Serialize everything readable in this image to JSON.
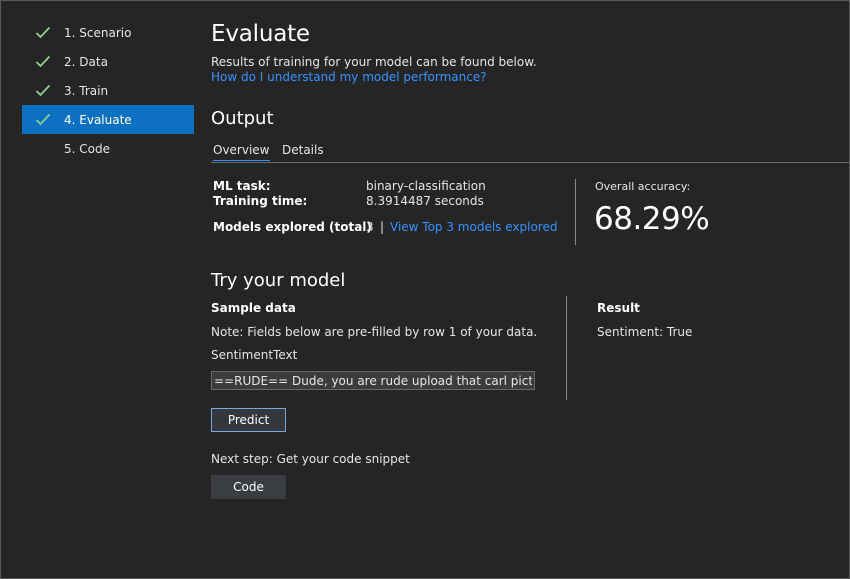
{
  "sidebar": {
    "steps": [
      {
        "label": "1. Scenario",
        "completed": true
      },
      {
        "label": "2. Data",
        "completed": true
      },
      {
        "label": "3. Train",
        "completed": true
      },
      {
        "label": "4. Evaluate",
        "completed": true,
        "active": true
      },
      {
        "label": "5. Code",
        "completed": false
      }
    ]
  },
  "header": {
    "title": "Evaluate",
    "subtitle": "Results of training for your model can be found below.",
    "help_link": "How do I understand my model performance?"
  },
  "output": {
    "title": "Output",
    "tabs": [
      {
        "label": "Overview",
        "selected": true
      },
      {
        "label": "Details",
        "selected": false
      }
    ],
    "ml_task_label": "ML task:",
    "ml_task_value": "binary-classification",
    "training_time_label": "Training time:",
    "training_time_value": "8.3914487 seconds",
    "models_explored_label": "Models explored (total)",
    "models_explored_value": "3",
    "view_top_models_link": "View Top 3 models explored",
    "accuracy_label": "Overall accuracy:",
    "accuracy_value": "68.29%"
  },
  "try_model": {
    "title": "Try your model",
    "sample_heading": "Sample data",
    "note": "Note: Fields below are pre-filled by row 1 of your data.",
    "field_label": "SentimentText",
    "field_value": "==RUDE== Dude, you are rude upload that carl picture back",
    "predict_label": "Predict",
    "result_heading": "Result",
    "result_value": "Sentiment: True"
  },
  "next_step": {
    "text": "Next step: Get your code snippet",
    "code_button": "Code"
  },
  "colors": {
    "background": "#252526",
    "accent": "#0e70c0",
    "link": "#3794ff",
    "check": "#8fd08f"
  }
}
